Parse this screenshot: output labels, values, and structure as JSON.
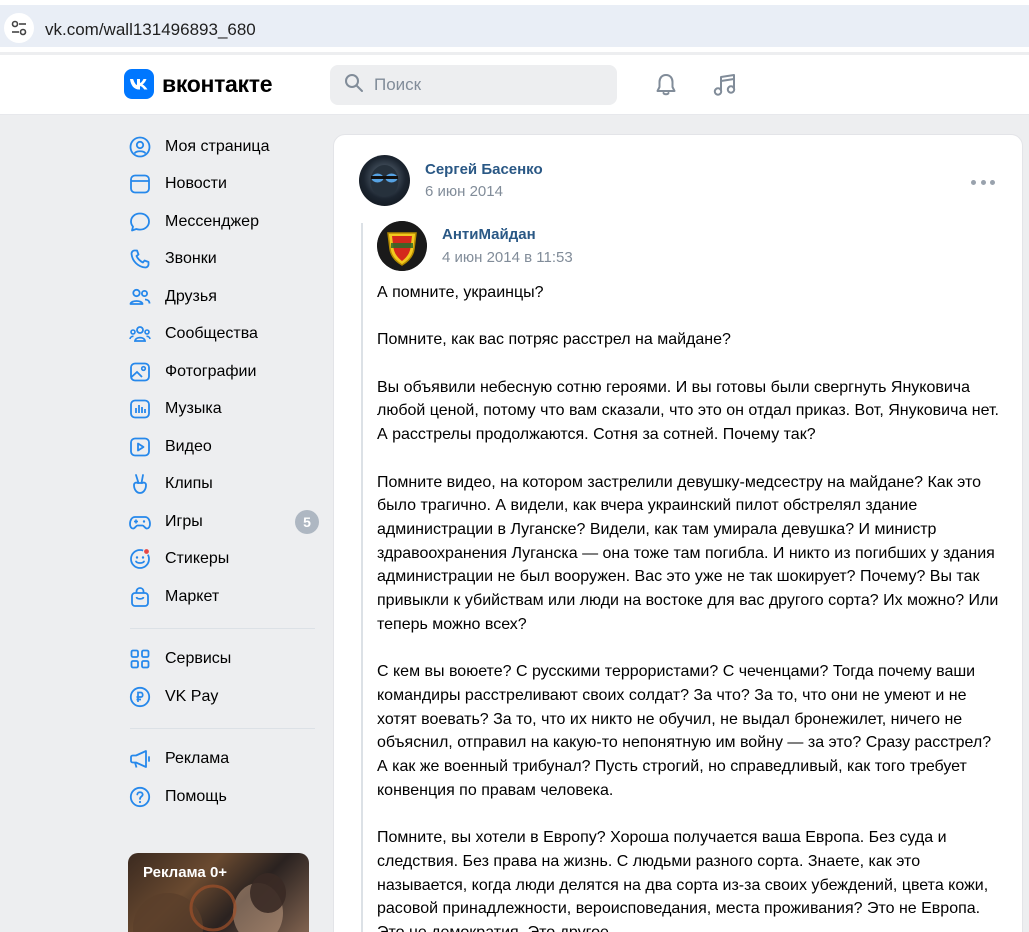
{
  "browser": {
    "url": "vk.com/wall131496893_680"
  },
  "header": {
    "logo_text": "вконтакте",
    "search_placeholder": "Поиск"
  },
  "sidebar": {
    "items": [
      {
        "label": "Моя страница",
        "icon": "user-circle-icon"
      },
      {
        "label": "Новости",
        "icon": "news-icon"
      },
      {
        "label": "Мессенджер",
        "icon": "chat-bubble-icon"
      },
      {
        "label": "Звонки",
        "icon": "phone-icon"
      },
      {
        "label": "Друзья",
        "icon": "friends-icon"
      },
      {
        "label": "Сообщества",
        "icon": "communities-icon"
      },
      {
        "label": "Фотографии",
        "icon": "photo-icon"
      },
      {
        "label": "Музыка",
        "icon": "music-bars-icon"
      },
      {
        "label": "Видео",
        "icon": "video-play-icon"
      },
      {
        "label": "Клипы",
        "icon": "clips-icon"
      },
      {
        "label": "Игры",
        "icon": "gamepad-icon",
        "badge": "5"
      },
      {
        "label": "Стикеры",
        "icon": "sticker-icon"
      },
      {
        "label": "Маркет",
        "icon": "shopping-bag-icon"
      }
    ],
    "items2": [
      {
        "label": "Сервисы",
        "icon": "services-grid-icon"
      },
      {
        "label": "VK Pay",
        "icon": "ruble-icon"
      }
    ],
    "items3": [
      {
        "label": "Реклама",
        "icon": "megaphone-icon"
      },
      {
        "label": "Помощь",
        "icon": "help-icon"
      }
    ],
    "ad_label": "Реклама 0+"
  },
  "post": {
    "author": "Сергей Басенко",
    "date": "6 июн 2014",
    "repost": {
      "author": "АнтиМайдан",
      "date": "4 июн 2014 в 11:53"
    },
    "paragraphs": [
      "А помните, украинцы?",
      "Помните, как вас потряс расстрел на майдане?",
      "Вы объявили небесную сотню героями. И вы готовы были свергнуть Януковича любой ценой, потому что вам сказали, что это он отдал приказ. Вот, Януковича нет. А расстрелы продолжаются. Сотня за сотней. Почему так?",
      "Помните видео, на котором застрелили девушку-медсестру на майдане? Как это было трагично. А видели, как вчера украинский пилот обстрелял здание администрации в Луганске? Видели, как там умирала девушка? И министр здравоохранения Луганска — она тоже там погибла. И никто из погибших у здания администрации не был вооружен. Вас это уже не так шокирует? Почему? Вы так привыкли к убийствам или люди на востоке для вас другого сорта? Их можно? Или теперь можно всех?",
      "С кем вы воюете? С русскими террористами? С чеченцами? Тогда почему ваши командиры расстреливают своих солдат? За что? За то, что они не умеют и не хотят воевать? За то, что их никто не обучил, не выдал бронежилет, ничего не объяснил, отправил на какую-то непонятную им войну — за это? Сразу расстрел? А как же военный трибунал? Пусть строгий, но справедливый, как того требует конвенция по правам человека.",
      "Помните, вы хотели в Европу? Хороша получается ваша Европа. Без суда и следствия. Без права на жизнь. С людьми разного сорта. Знаете, как это называется, когда люди делятся на два сорта из-за своих убеждений, цвета кожи, расовой принадлежности, вероисповедания, места проживания? Это не Европа. Это не демократия. Это другое."
    ]
  }
}
